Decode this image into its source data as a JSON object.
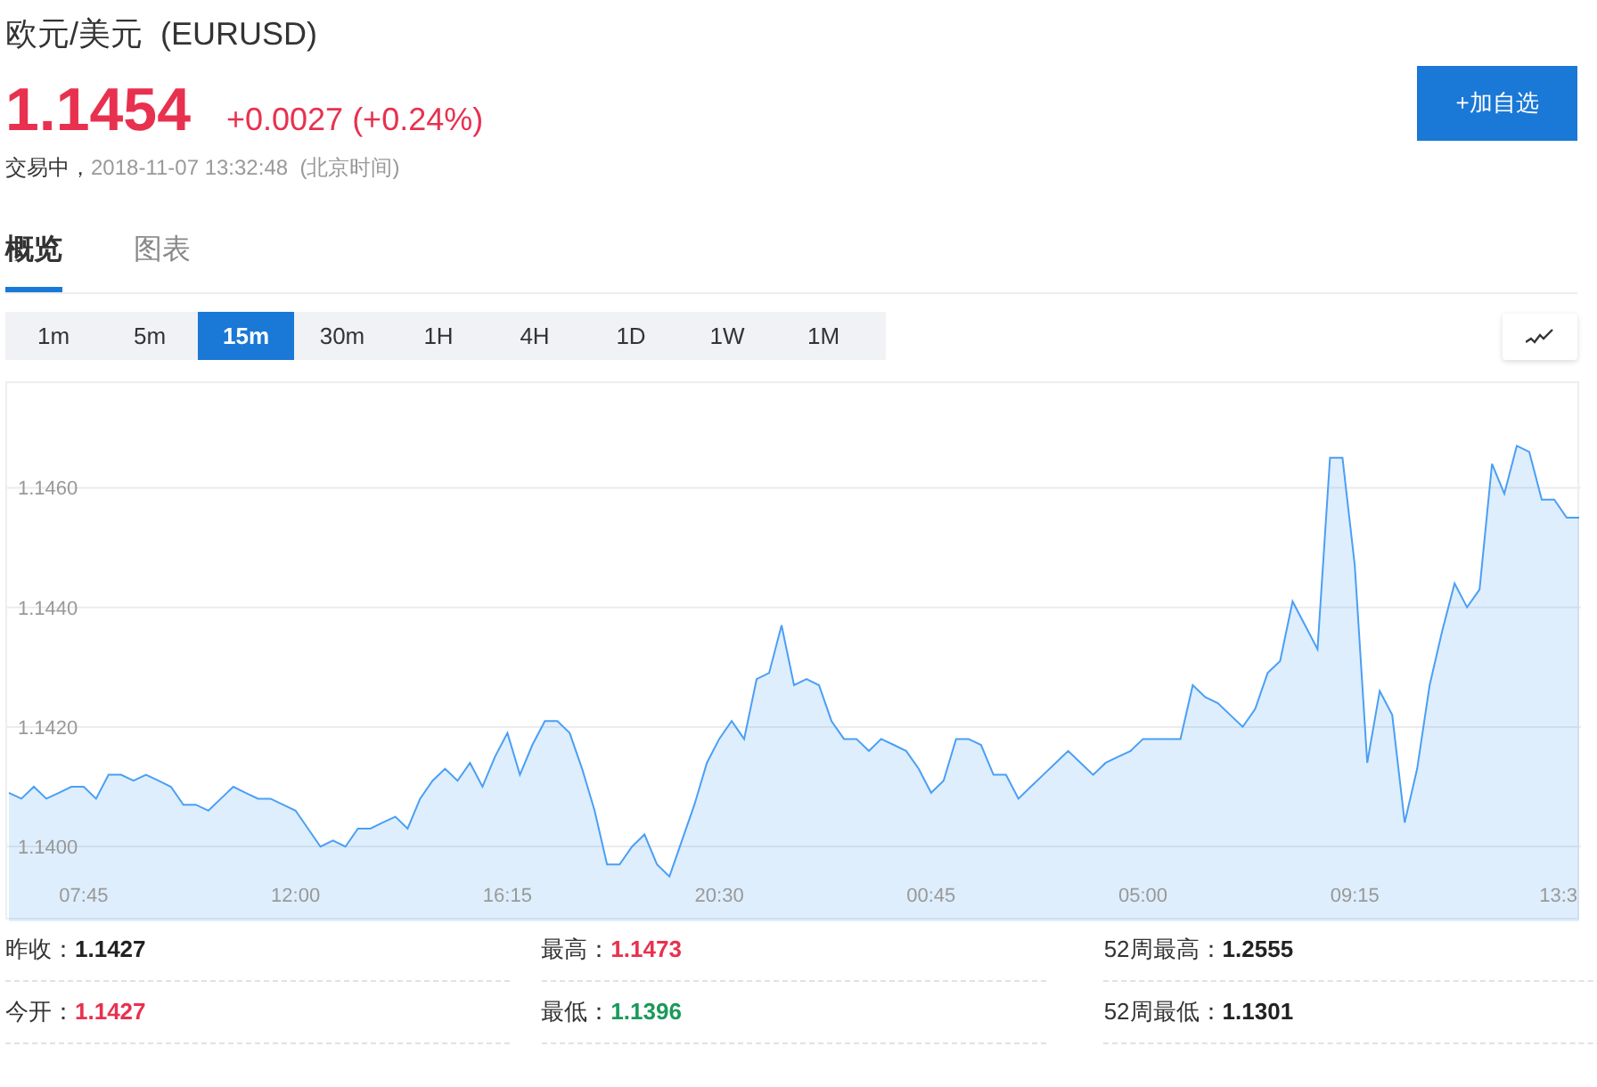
{
  "header": {
    "title": "欧元/美元  (EURUSD)",
    "price": "1.1454",
    "change": "+0.0027 (+0.24%)",
    "status": "交易中，",
    "timestamp": "2018-11-07 13:32:48  (北京时间)",
    "add_button": "+加自选"
  },
  "tabs": [
    {
      "label": "概览",
      "selected": true
    },
    {
      "label": "图表",
      "selected": false
    }
  ],
  "periods": [
    {
      "label": "1m",
      "selected": false
    },
    {
      "label": "5m",
      "selected": false
    },
    {
      "label": "15m",
      "selected": true
    },
    {
      "label": "30m",
      "selected": false
    },
    {
      "label": "1H",
      "selected": false
    },
    {
      "label": "4H",
      "selected": false
    },
    {
      "label": "1D",
      "selected": false
    },
    {
      "label": "1W",
      "selected": false
    },
    {
      "label": "1M",
      "selected": false
    }
  ],
  "chart": {
    "chart_data": {
      "type": "area",
      "grid": true,
      "ylim": [
        1.13875,
        1.14775
      ],
      "yticks": [
        {
          "value": 1.14,
          "label": "1.1400"
        },
        {
          "value": 1.142,
          "label": "1.1420"
        },
        {
          "value": 1.144,
          "label": "1.1440"
        },
        {
          "value": 1.146,
          "label": "1.1460"
        }
      ],
      "categories": [
        null,
        null,
        null,
        null,
        null,
        null,
        "07:45",
        null,
        null,
        null,
        null,
        null,
        null,
        null,
        null,
        null,
        null,
        null,
        null,
        null,
        null,
        null,
        null,
        "12:00",
        null,
        null,
        null,
        null,
        null,
        null,
        null,
        null,
        null,
        null,
        null,
        null,
        null,
        null,
        null,
        null,
        "16:15",
        null,
        null,
        null,
        null,
        null,
        null,
        null,
        null,
        null,
        null,
        null,
        null,
        null,
        null,
        null,
        null,
        "20:30",
        null,
        null,
        null,
        null,
        null,
        null,
        null,
        null,
        null,
        null,
        null,
        null,
        null,
        null,
        null,
        null,
        "00:45",
        null,
        null,
        null,
        null,
        null,
        null,
        null,
        null,
        null,
        null,
        null,
        null,
        null,
        null,
        null,
        null,
        "05:00",
        null,
        null,
        null,
        null,
        null,
        null,
        null,
        null,
        null,
        null,
        null,
        null,
        null,
        null,
        null,
        null,
        "09:15",
        null,
        null,
        null,
        null,
        null,
        null,
        null,
        null,
        null,
        null,
        null,
        null,
        null,
        null,
        null,
        null,
        "13:3",
        null
      ],
      "series": [
        {
          "color": "#4a9ff5",
          "values": [
            1.1409,
            1.1408,
            1.141,
            1.1408,
            1.1409,
            1.141,
            1.141,
            1.1408,
            1.1412,
            1.1412,
            1.1411,
            1.1412,
            1.1411,
            1.141,
            1.1407,
            1.1407,
            1.1406,
            1.1408,
            1.141,
            1.1409,
            1.1408,
            1.1408,
            1.1407,
            1.1406,
            1.1403,
            1.14,
            1.1401,
            1.14,
            1.1403,
            1.1403,
            1.1404,
            1.1405,
            1.1403,
            1.1408,
            1.1411,
            1.1413,
            1.1411,
            1.1414,
            1.141,
            1.1415,
            1.1419,
            1.1412,
            1.1417,
            1.1421,
            1.1421,
            1.1419,
            1.1413,
            1.1406,
            1.1397,
            1.1397,
            1.14,
            1.1402,
            1.1397,
            1.1395,
            1.1401,
            1.1407,
            1.1414,
            1.1418,
            1.1421,
            1.1418,
            1.1428,
            1.1429,
            1.1437,
            1.1427,
            1.1428,
            1.1427,
            1.1421,
            1.1418,
            1.1418,
            1.1416,
            1.1418,
            1.1417,
            1.1416,
            1.1413,
            1.1409,
            1.1411,
            1.1418,
            1.1418,
            1.1417,
            1.1412,
            1.1412,
            1.1408,
            1.141,
            1.1412,
            1.1414,
            1.1416,
            1.1414,
            1.1412,
            1.1414,
            1.1415,
            1.1416,
            1.1418,
            1.1418,
            1.1418,
            1.1418,
            1.1427,
            1.1425,
            1.1424,
            1.1422,
            1.142,
            1.1423,
            1.1429,
            1.1431,
            1.1441,
            1.1437,
            1.1433,
            1.1465,
            1.1465,
            1.1447,
            1.1414,
            1.1426,
            1.1422,
            1.1404,
            1.1413,
            1.1427,
            1.1436,
            1.1444,
            1.144,
            1.1443,
            1.1464,
            1.1459,
            1.1467,
            1.1466,
            1.1458,
            1.1458,
            1.1455,
            1.1455
          ]
        }
      ]
    }
  },
  "stats": [
    {
      "label": "昨收：",
      "value": "1.1427",
      "color": "#222222"
    },
    {
      "label": "最高：",
      "value": "1.1473",
      "color": "#e8314f"
    },
    {
      "label": "52周最高：",
      "value": "1.2555",
      "color": "#222222"
    },
    {
      "label": "今开：",
      "value": "1.1427",
      "color": "#e8314f"
    },
    {
      "label": "最低：",
      "value": "1.1396",
      "color": "#1a9a5a"
    },
    {
      "label": "52周最低：",
      "value": "1.1301",
      "color": "#222222"
    }
  ]
}
